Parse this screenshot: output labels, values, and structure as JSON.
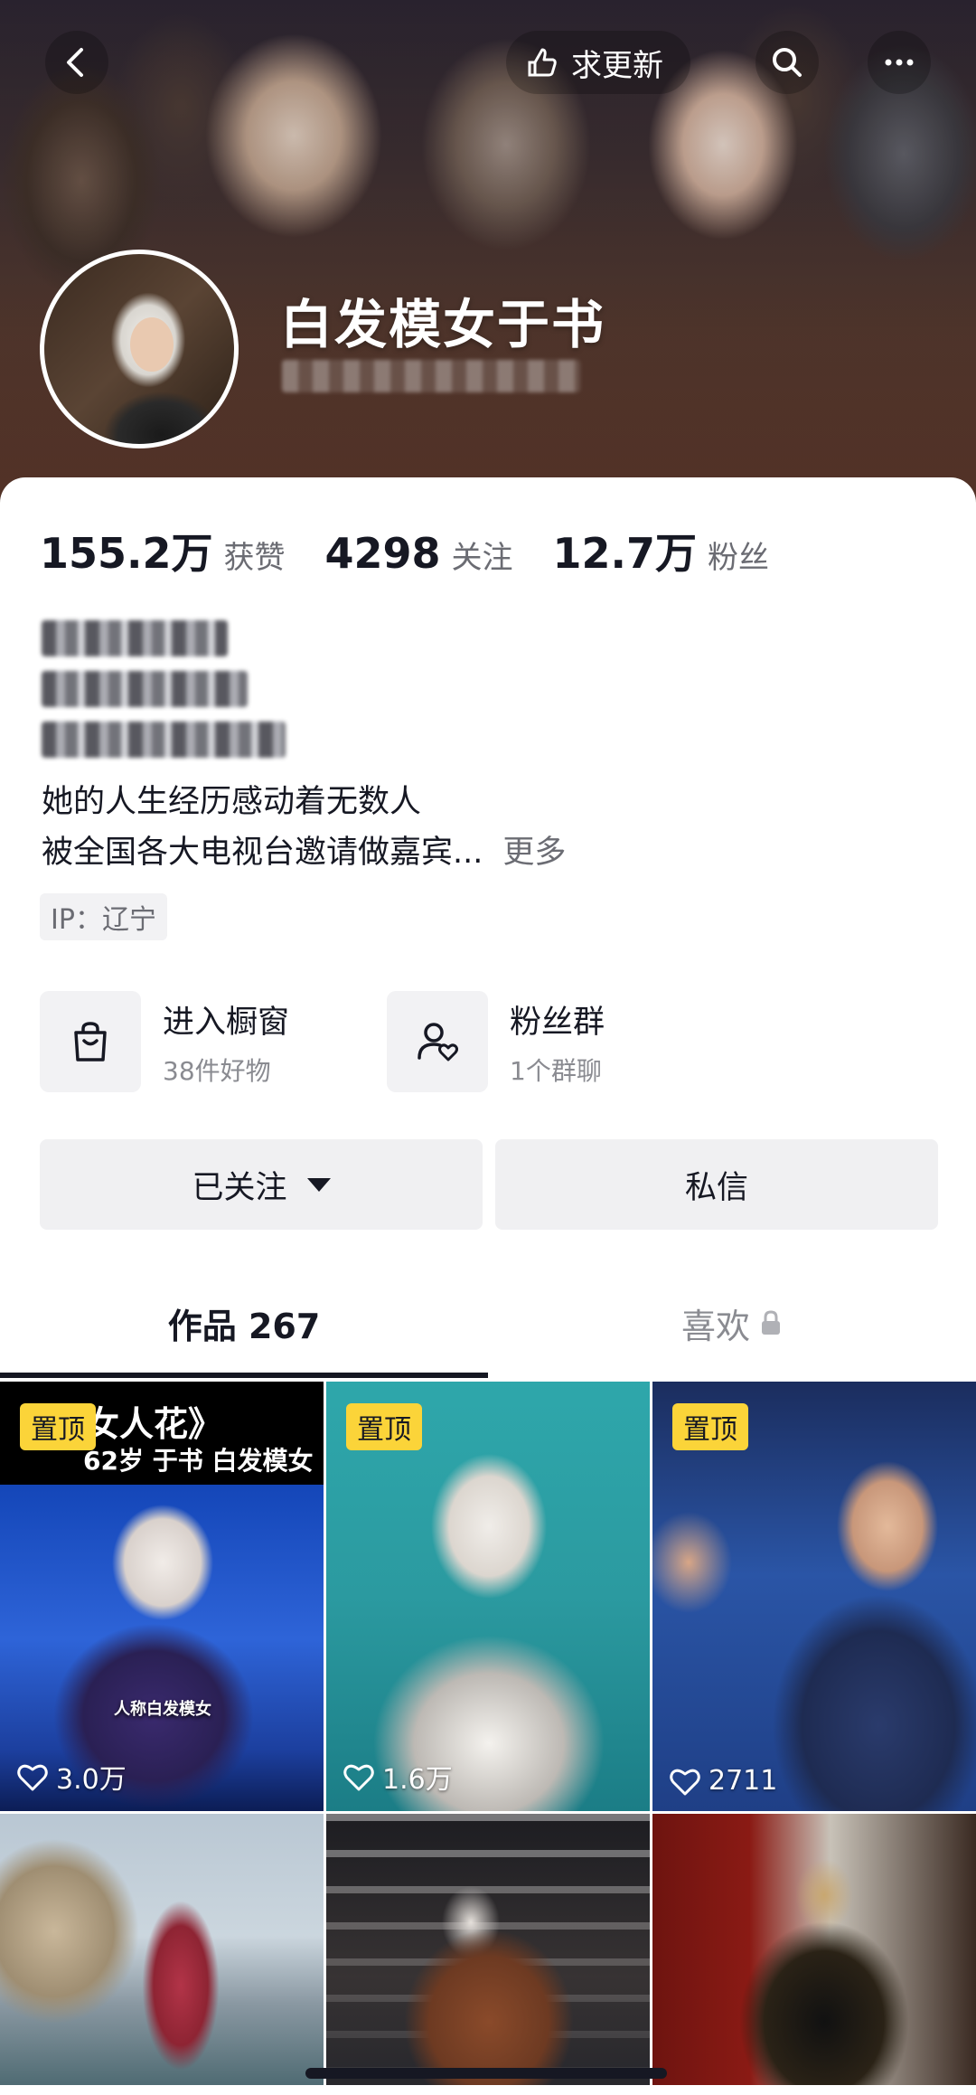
{
  "header": {
    "back_icon": "chevron-left-icon",
    "update_label": "求更新",
    "search_icon": "search-icon",
    "more_icon": "more-icon"
  },
  "profile": {
    "nickname": "白发模女于书"
  },
  "stats": [
    {
      "value": "155.2万",
      "label": "获赞"
    },
    {
      "value": "4298",
      "label": "关注"
    },
    {
      "value": "12.7万",
      "label": "粉丝"
    }
  ],
  "bio": {
    "line1": "她的人生经历感动着无数人",
    "line2": "被全国各大电视台邀请做嘉宾...",
    "more": "更多"
  },
  "ip": "IP：辽宁",
  "entries": {
    "shop": {
      "title": "进入橱窗",
      "subtitle": "38件好物"
    },
    "fans_group": {
      "title": "粉丝群",
      "subtitle": "1个群聊"
    }
  },
  "actions": {
    "followed": "已关注",
    "message": "私信"
  },
  "tabs": {
    "works": "作品 267",
    "likes": "喜欢"
  },
  "videos": [
    {
      "pinned": "置顶",
      "likes": "3.0万",
      "caption_top": "《女人花》",
      "caption_sub": "62岁 于书 白发模女",
      "caption_bottom": "人称白发模女"
    },
    {
      "pinned": "置顶",
      "likes": "1.6万"
    },
    {
      "pinned": "置顶",
      "likes": "2711"
    },
    {},
    {},
    {}
  ],
  "colors": {
    "pin_badge": "#fbd439",
    "text_primary": "#161823",
    "text_secondary": "#6b6c73"
  }
}
